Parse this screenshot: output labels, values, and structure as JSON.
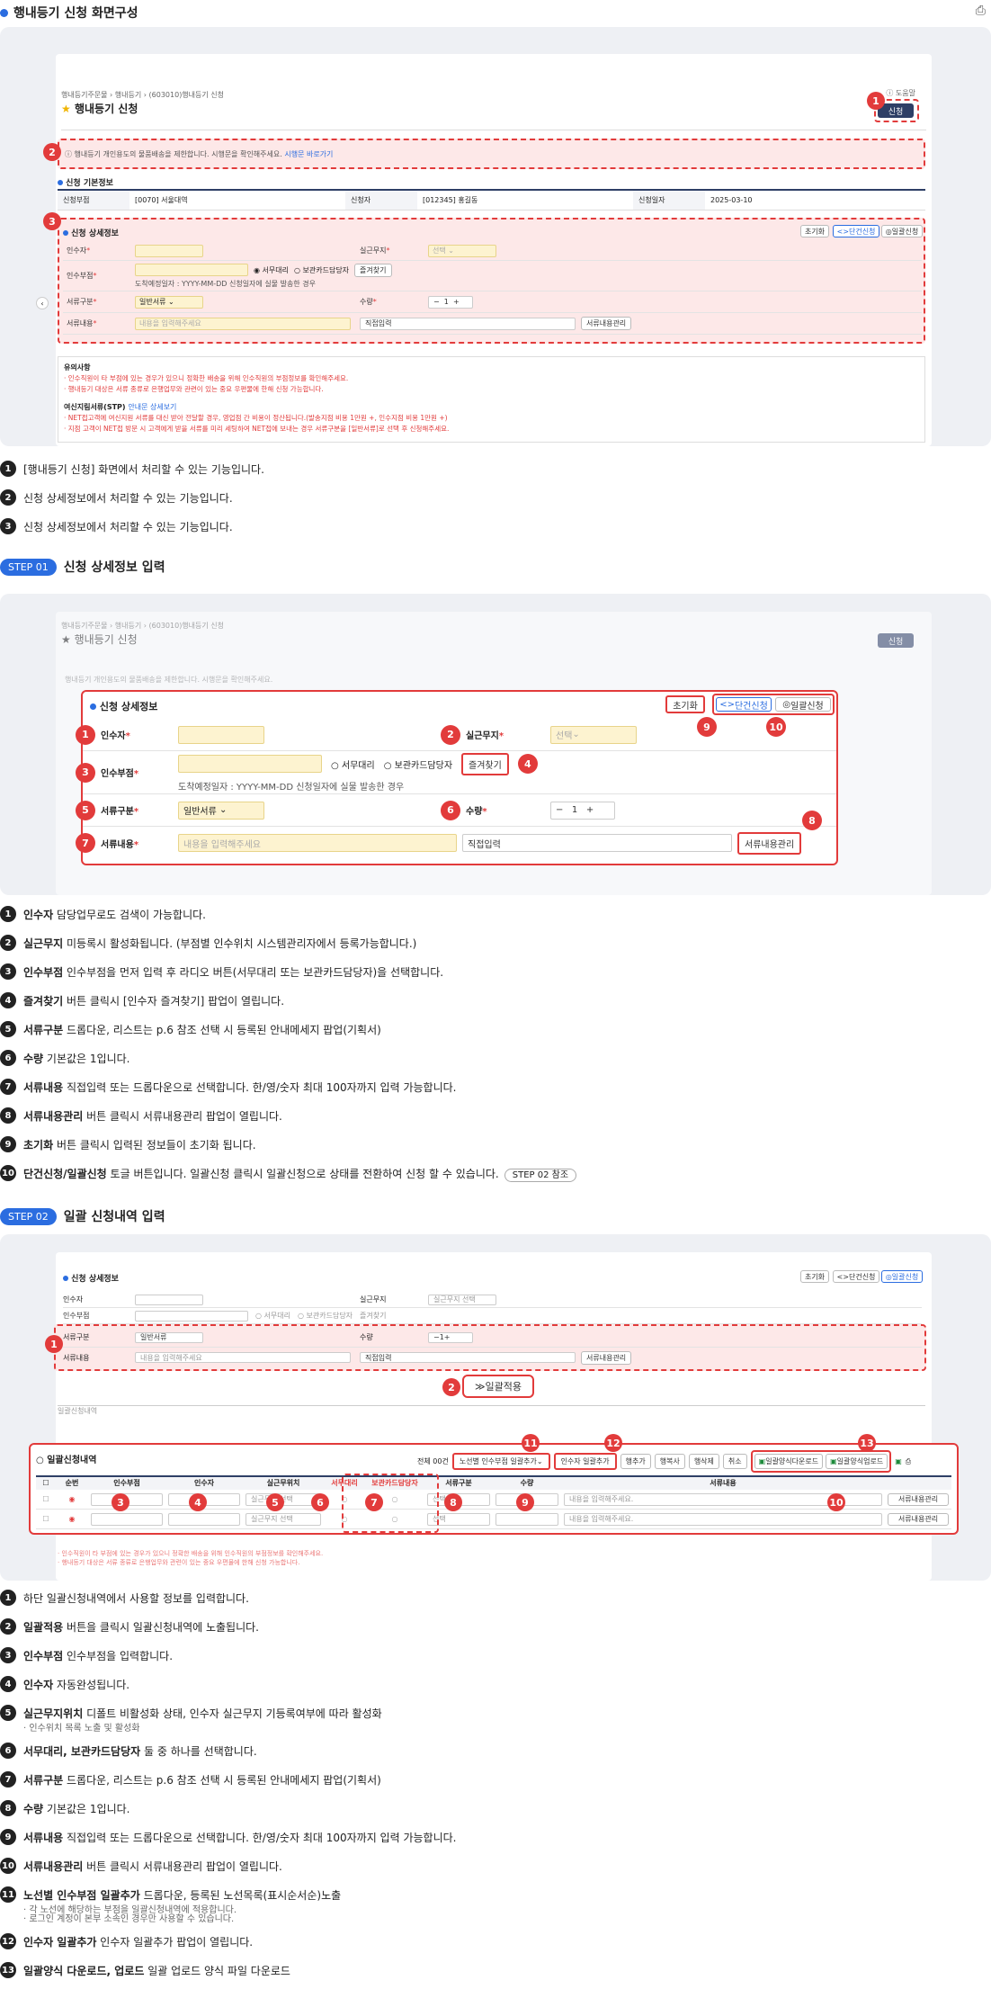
{
  "header": {
    "title": "행내등기 신청 화면구성"
  },
  "shot1": {
    "breadcrumb": "행내등기주문물 › 행내등기 › (603010)행내등기 신청",
    "page_title": "행내등기 신청",
    "help": "도움말",
    "submit": "신청",
    "notice": "행내등기 개인용도의 물품배송을 제한합니다. 시행문을 확인해주세요.",
    "notice_link": "시행문 바로가기",
    "basic_title": "신청 기본정보",
    "basic": [
      {
        "k": "신청부점",
        "v": "[0070] 서울대역"
      },
      {
        "k": "신청자",
        "v": "[012345] 홍길동"
      },
      {
        "k": "신청일자",
        "v": "2025-03-10"
      }
    ],
    "detail_title": "신청 상세정보",
    "reset": "초기화",
    "single": "단건신청",
    "bulk": "일괄신청",
    "f_recipient": "인수자",
    "f_floor": "실근무지",
    "f_select": "선택",
    "f_dept": "인수부점",
    "r1": "서무대리",
    "r2": "보관카드담당자",
    "fav": "즐겨찾기",
    "date_note": "도착예정일자 : YYYY-MM-DD 신청일자에 실물 발송한 경우",
    "f_type": "서류구분",
    "type_val": "일반서류",
    "f_qty": "수량",
    "qty": "1",
    "f_content": "서류내용",
    "content_ph": "내용을 입력해주세요",
    "direct": "직접입력",
    "manage": "서류내용관리",
    "caution_title": "유의사항",
    "caution1": "· 인수직원이 타 부점에 있는 경우가 있으니 정확한 배송을 위해 인수직원의 부점정보를 확인해주세요.",
    "caution2": "· 행내등기 대상은 서류 종류로 은행업무와 관련이 있는 중요 우편물에 한해 신청 가능합니다.",
    "stp_title": "여신지림서류(STP)",
    "stp_link": "안내문 상세보기",
    "stp1": "· NET접고객에 여신지원 서류를 대신 받아 전달할 경우, 영업점 간 비용이 정산됩니다.(발송지점 비용 1만원 +, 인수지점 비용 1만원 +)",
    "stp2": "· 지점 고객이 NET접 방문 시 고객에게 받을 서류를 미리 세팅하여 NET접에 보내는 경우 서류구분을 [일반서류]로 선택 후 신청해주세요."
  },
  "list1": [
    {
      "n": "1",
      "b": "",
      "t": "[행내등기 신청] 화면에서 처리할 수 있는 기능입니다."
    },
    {
      "n": "2",
      "b": "",
      "t": "신청 상세정보에서 처리할 수 있는 기능입니다."
    },
    {
      "n": "3",
      "b": "",
      "t": "신청 상세정보에서 처리할 수 있는 기능입니다."
    }
  ],
  "step1": {
    "badge": "STEP 01",
    "title": "신청 상세정보 입력"
  },
  "list2": [
    {
      "n": "1",
      "b": "인수자",
      "t": "담당업무로도 검색이 가능합니다."
    },
    {
      "n": "2",
      "b": "실근무지",
      "t": "미등록시 활성화됩니다. (부점별 인수위치 시스템관리자에서 등록가능합니다.)"
    },
    {
      "n": "3",
      "b": "인수부점",
      "t": "인수부점을 먼저 입력 후 라디오 버튼(서무대리 또는 보관카드담당자)을 선택합니다."
    },
    {
      "n": "4",
      "b": "즐겨찾기",
      "t": "버튼 클릭시 [인수자 즐겨찾기] 팝업이 열립니다."
    },
    {
      "n": "5",
      "b": "서류구분",
      "t": "드롭다운, 리스트는 p.6 참조 선택 시 등록된 안내메세지 팝업(기획서)"
    },
    {
      "n": "6",
      "b": "수량",
      "t": "기본값은 1입니다."
    },
    {
      "n": "7",
      "b": "서류내용",
      "t": "직접입력 또는 드롭다운으로 선택합니다. 한/영/숫자 최대 100자까지 입력 가능합니다."
    },
    {
      "n": "8",
      "b": "서류내용관리",
      "t": "버튼 클릭시 서류내용관리 팝업이 열립니다."
    },
    {
      "n": "9",
      "b": "초기화",
      "t": "버튼 클릭시 입력된 정보들이 초기화 됩니다."
    },
    {
      "n": "10",
      "b": "단건신청/일괄신청",
      "t": "토글 버튼입니다. 일괄신청 클릭시 일괄신청으로 상태를 전환하여 신청 할 수 있습니다.",
      "chip": "STEP 02 참조"
    }
  ],
  "step2": {
    "badge": "STEP 02",
    "title": "일괄 신청내역 입력"
  },
  "shot3": {
    "bulk_apply": "일괄적용",
    "list_title": "일괄신청내역",
    "total": "전체 00건",
    "b1": "노선별 인수부점 일괄추가",
    "b2": "인수자 일괄추가",
    "b3": "행추가",
    "b4": "행복사",
    "b5": "행삭제",
    "b6": "취소",
    "b7": "일괄양식다운로드",
    "b8": "일괄양식업로드",
    "cols": [
      "순번",
      "인수부점",
      "인수자",
      "실근무위치",
      "서무대리",
      "보관카드담당자",
      "서류구분",
      "수량",
      "서류내용"
    ],
    "floor_ph": "실근무지 선택",
    "sel": "선택",
    "content_ph": "내용을 입력해주세요.",
    "manage": "서류내용관리"
  },
  "list3": [
    {
      "n": "1",
      "b": "",
      "t": "하단 일괄신청내역에서 사용할 정보를 입력합니다."
    },
    {
      "n": "2",
      "b": "일괄적용",
      "t": "버튼을 클릭시 일괄신청내역에 노출됩니다."
    },
    {
      "n": "3",
      "b": "인수부점",
      "t": "인수부점을 입력합니다."
    },
    {
      "n": "4",
      "b": "인수자",
      "t": "자동완성됩니다."
    },
    {
      "n": "5",
      "b": "실근무지위치",
      "t": "디폴트 비활성화 상태, 인수자 실근무지 기등록여부에 따라 활성화",
      "sub": [
        "· 인수위치 목록 노출 및 활성화"
      ]
    },
    {
      "n": "6",
      "b": "서무대리, 보관카드담당자",
      "t": "둘 중 하나를 선택합니다."
    },
    {
      "n": "7",
      "b": "서류구분",
      "t": "드롭다운, 리스트는 p.6 참조 선택 시 등록된 안내메세지 팝업(기획서)"
    },
    {
      "n": "8",
      "b": "수량",
      "t": "기본값은 1입니다."
    },
    {
      "n": "9",
      "b": "서류내용",
      "t": "직접입력 또는 드롭다운으로 선택합니다. 한/영/숫자 최대 100자까지 입력 가능합니다."
    },
    {
      "n": "10",
      "b": "서류내용관리",
      "t": "버튼 클릭시 서류내용관리 팝업이 열립니다."
    },
    {
      "n": "11",
      "b": "노선별 인수부점 일괄추가",
      "t": "드롭다운, 등록된 노선목록(표시순서순)노출",
      "sub": [
        "· 각 노선에 해당하는 부점을 일괄신청내역에 적용합니다.",
        "· 로그인 계정이 본부 소속인 경우만 사용할 수 있습니다."
      ]
    },
    {
      "n": "12",
      "b": "인수자 일괄추가",
      "t": "인수자 일괄추가 팝업이 열립니다."
    },
    {
      "n": "13",
      "b": "일괄양식 다운로드, 업로드",
      "t": "일괄 업로드 양식 파일 다운로드"
    }
  ]
}
